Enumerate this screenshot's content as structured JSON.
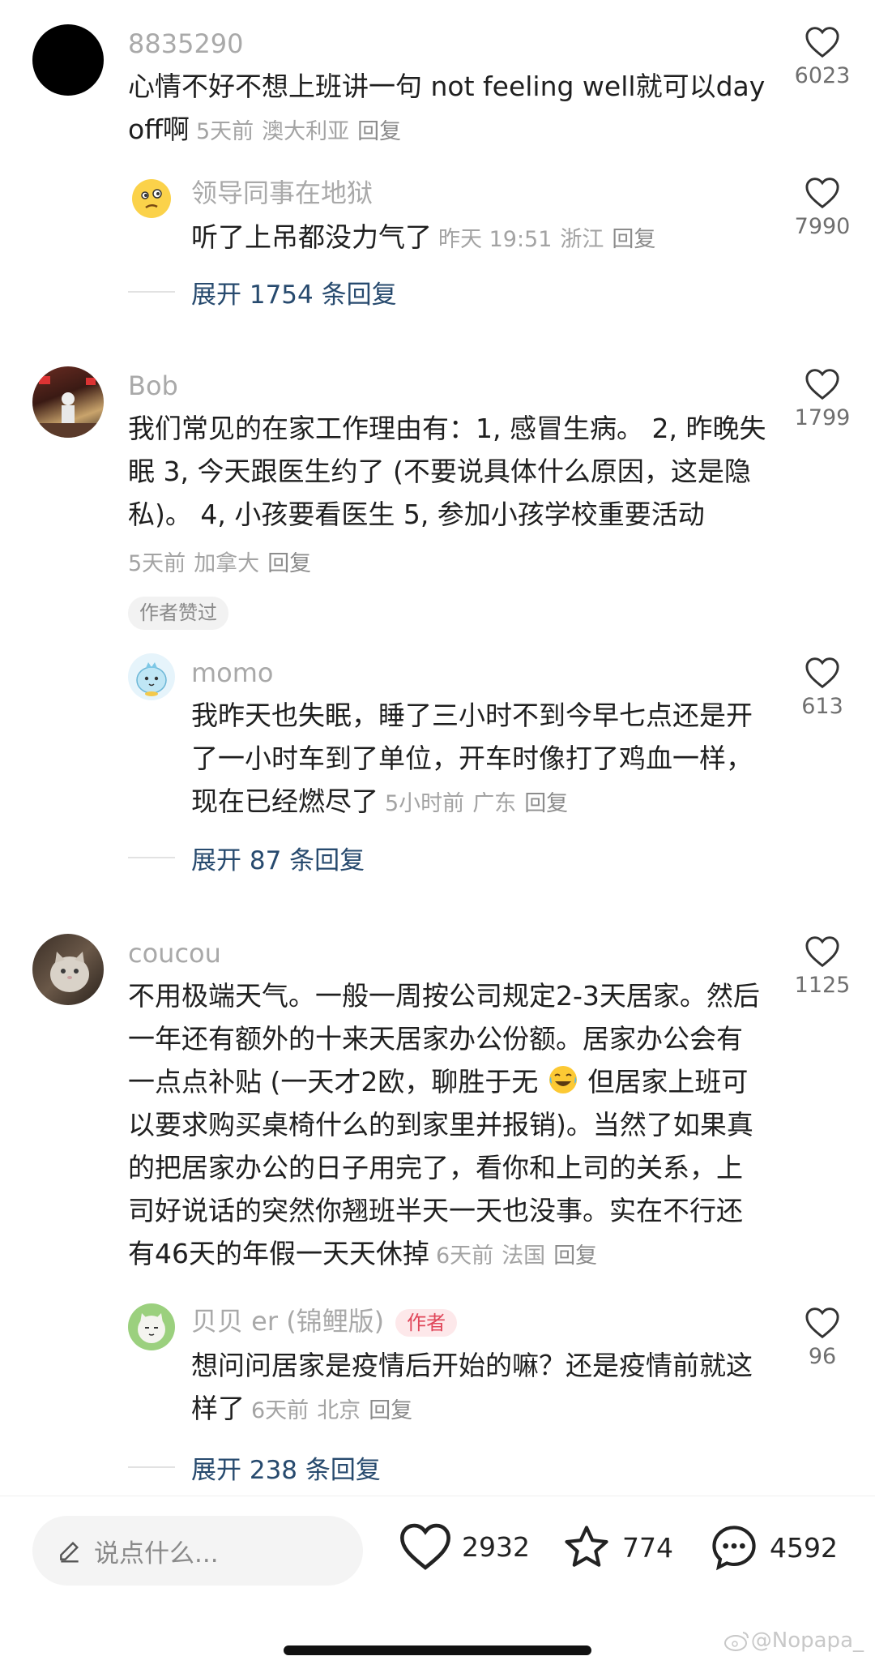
{
  "comments": [
    {
      "user": "8835290",
      "text": "心情不好不想上班讲一句 not feeling well就可以day off啊",
      "time": "5天前",
      "location": "澳大利亚",
      "reply_label": "回复",
      "likes": "6023",
      "reply": {
        "user": "领导同事在地狱",
        "text": "听了上吊都没力气了",
        "time": "昨天 19:51",
        "location": "浙江",
        "reply_label": "回复",
        "likes": "7990"
      },
      "expand": "展开 1754 条回复"
    },
    {
      "user": "Bob",
      "text": "我们常见的在家工作理由有：1, 感冒生病。 2, 昨晚失眠 3, 今天跟医生约了 (不要说具体什么原因，这是隐私)。 4, 小孩要看医生  5, 参加小孩学校重要活动",
      "time": "5天前",
      "location": "加拿大",
      "reply_label": "回复",
      "likes": "1799",
      "badge": "作者赞过",
      "reply": {
        "user": "momo",
        "text": "我昨天也失眠，睡了三小时不到今早七点还是开了一小时车到了单位，开车时像打了鸡血一样，现在已经燃尽了",
        "time": "5小时前",
        "location": "广东",
        "reply_label": "回复",
        "likes": "613"
      },
      "expand": "展开 87 条回复"
    },
    {
      "user": "coucou",
      "text_part1": "不用极端天气。一般一周按公司规定2-3天居家。然后一年还有额外的十来天居家办公份额。居家办公会有一点点补贴 (一天才2欧，聊胜于无 ",
      "text_part2": " 但居家上班可以要求购买桌椅什么的到家里并报销)。当然了如果真的把居家办公的日子用完了，看你和上司的关系，上司好说话的突然你翘班半天一天也没事。实在不行还有46天的年假一天天休掉",
      "time": "6天前",
      "location": "法国",
      "reply_label": "回复",
      "likes": "1125",
      "reply": {
        "user": "贝贝 er (锦鲤版)",
        "author_badge": "作者",
        "text": "想问问居家是疫情后开始的嘛？还是疫情前就这样了",
        "time": "6天前",
        "location": "北京",
        "reply_label": "回复",
        "likes": "96"
      },
      "expand": "展开 238 条回复"
    }
  ],
  "bottom_bar": {
    "placeholder": "说点什么...",
    "likes": "2932",
    "stars": "774",
    "comments": "4592"
  },
  "watermark": "@Nopapa_"
}
